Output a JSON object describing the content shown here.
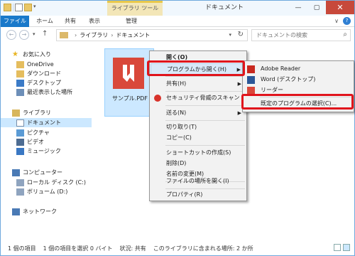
{
  "titlebar": {
    "contextual_tab": "ライブラリ ツール",
    "title": "ドキュメント",
    "minimize": "—",
    "maximize": "▢",
    "close": "✕"
  },
  "ribbon": {
    "tabs": [
      "ファイル",
      "ホーム",
      "共有",
      "表示",
      "管理"
    ],
    "expand": "∨",
    "help": "?"
  },
  "address": {
    "back": "←",
    "forward": "→",
    "up": "↑",
    "crumb_arrow": "›",
    "crumbs": [
      "ライブラリ",
      "ドキュメント"
    ],
    "search_placeholder": "ドキュメントの検索"
  },
  "nav": {
    "favorites_label": "お気に入り",
    "favorites": [
      "OneDrive",
      "ダウンロード",
      "デスクトップ",
      "最近表示した場所"
    ],
    "libraries_label": "ライブラリ",
    "libraries": [
      "ドキュメント",
      "ピクチャ",
      "ビデオ",
      "ミュージック"
    ],
    "computer_label": "コンピューター",
    "drives": [
      "ローカル ディスク (C:)",
      "ボリューム (D:)"
    ],
    "network_label": "ネットワーク"
  },
  "content": {
    "file_name": "サンプル.PDF"
  },
  "context_menu": {
    "items": [
      "開く(O)",
      "プログラムから開く(H)",
      "共有(H)",
      "セキュリティ脅威のスキャン",
      "送る(N)",
      "切り取り(T)",
      "コピー(C)",
      "ショートカットの作成(S)",
      "削除(D)",
      "名前の変更(M)",
      "ファイルの場所を開く(I)",
      "プロパティ(R)"
    ]
  },
  "submenu": {
    "items": [
      "Adobe Reader",
      "Word (デスクトップ)",
      "リーダー",
      "既定のプログラムの選択(C)..."
    ]
  },
  "statusbar": {
    "count": "1 個の項目",
    "selected": "1 個の項目を選択 0 バイト",
    "state": "状況: 共有",
    "locations": "このライブラリに含まれる場所: 2 か所"
  },
  "colors": {
    "accent": "#1979ca",
    "highlight": "#e0141c",
    "pdf_red": "#d9483a",
    "selection": "#cce8ff"
  }
}
